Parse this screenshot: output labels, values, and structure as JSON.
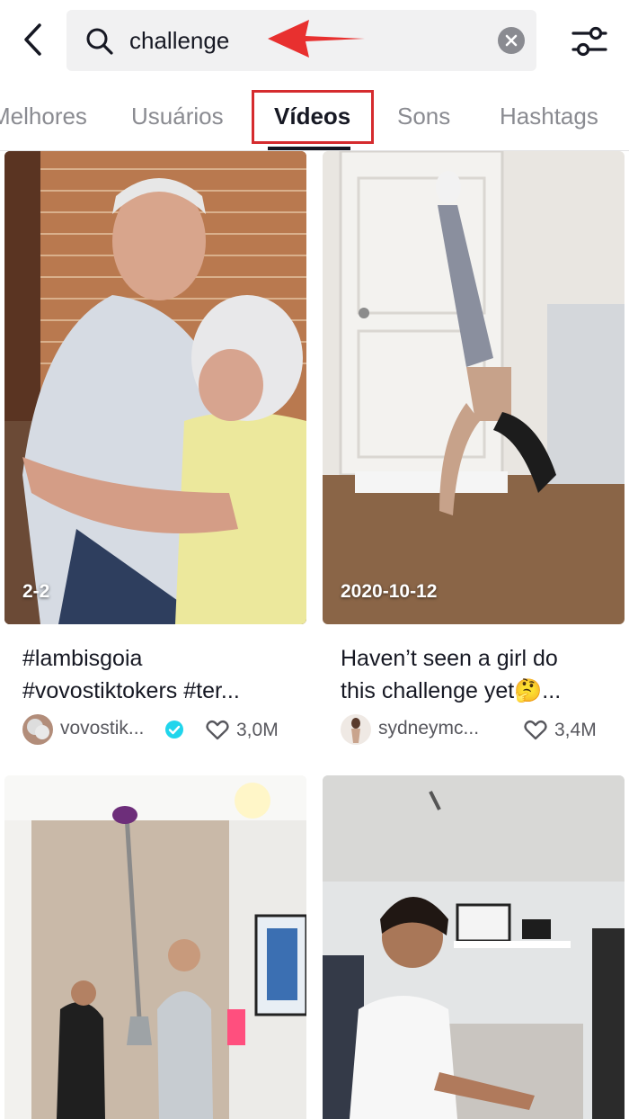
{
  "search": {
    "query": "challenge"
  },
  "tabs": [
    {
      "label": "Melhores"
    },
    {
      "label": "Usuários"
    },
    {
      "label": "Vídeos"
    },
    {
      "label": "Sons"
    },
    {
      "label": "Hashtags"
    }
  ],
  "videos": [
    {
      "date": "2-2",
      "caption_line1": "#lambisgoia",
      "caption_line2": "#vovostiktokers #ter...",
      "username": "vovostik...",
      "verified": true,
      "likes": "3,0M"
    },
    {
      "date": "2020-10-12",
      "caption_line1": "Haven’t seen a girl do",
      "caption_line2": "this challenge yet🤔...",
      "username": "sydneymc...",
      "verified": false,
      "likes": "3,4M"
    },
    {
      "date": "",
      "caption_line1": "",
      "caption_line2": "",
      "username": "",
      "likes": ""
    },
    {
      "date": "",
      "caption_line1": "",
      "caption_line2": "",
      "username": "",
      "likes": ""
    }
  ],
  "colors": {
    "highlight": "#d52b2e",
    "verified": "#20d5ec",
    "text_primary": "#161823",
    "text_secondary": "#8a8b91"
  },
  "icons": {
    "back": "chevron-left-icon",
    "search": "search-icon",
    "clear": "clear-icon",
    "filter": "filter-sliders-icon",
    "like": "heart-icon",
    "verified": "verified-badge-icon",
    "annotation": "red-arrow-icon"
  }
}
